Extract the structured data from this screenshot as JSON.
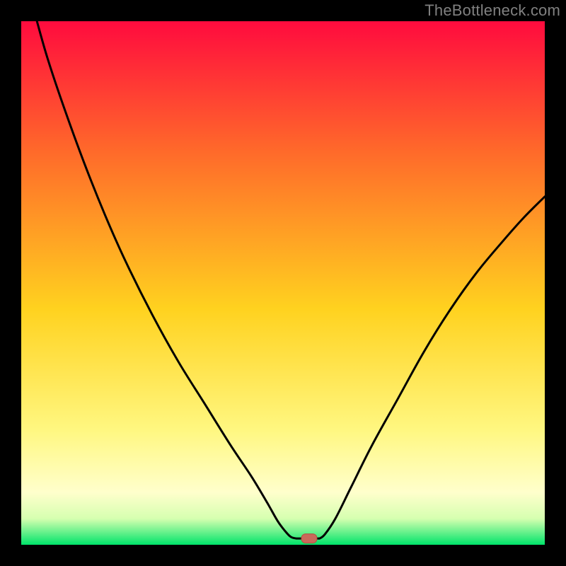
{
  "watermark": "TheBottleneck.com",
  "colors": {
    "frame": "#000000",
    "gradient_top": "#ff0b3e",
    "gradient_mid_upper": "#ff6a2a",
    "gradient_mid": "#ffd21f",
    "gradient_mid_lower": "#fff780",
    "gradient_lower": "#ffffcc",
    "gradient_band": "#d6ffb0",
    "gradient_bottom": "#00e46a",
    "curve": "#000000",
    "marker_fill": "#c96a5b",
    "marker_stroke": "#b84f40"
  },
  "chart_data": {
    "type": "line",
    "title": "",
    "xlabel": "",
    "ylabel": "",
    "xlim": [
      0,
      100
    ],
    "ylim": [
      0,
      100
    ],
    "left_curve_points": [
      [
        3,
        100
      ],
      [
        5,
        93
      ],
      [
        8,
        84
      ],
      [
        12,
        73
      ],
      [
        16,
        63
      ],
      [
        20,
        54
      ],
      [
        25,
        44
      ],
      [
        30,
        35
      ],
      [
        35,
        27
      ],
      [
        40,
        19
      ],
      [
        44,
        13
      ],
      [
        47,
        8
      ],
      [
        49,
        4.5
      ],
      [
        50.5,
        2.5
      ],
      [
        51.5,
        1.5
      ],
      [
        52.5,
        1.2
      ]
    ],
    "floor_points": [
      [
        52.5,
        1.2
      ],
      [
        57,
        1.2
      ]
    ],
    "right_curve_points": [
      [
        57,
        1.2
      ],
      [
        58,
        2
      ],
      [
        60,
        5
      ],
      [
        63,
        11
      ],
      [
        67,
        19
      ],
      [
        72,
        28
      ],
      [
        77,
        37
      ],
      [
        82,
        45
      ],
      [
        87,
        52
      ],
      [
        92,
        58
      ],
      [
        96,
        62.5
      ],
      [
        100,
        66.5
      ]
    ],
    "marker": {
      "x": 55,
      "y": 1.2
    }
  }
}
